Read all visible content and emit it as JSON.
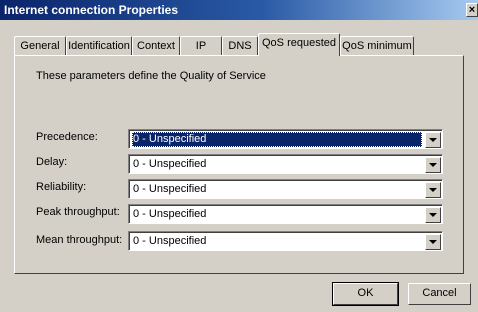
{
  "window": {
    "title": "Internet connection Properties",
    "close_glyph": "×"
  },
  "tabs": [
    {
      "label": "General"
    },
    {
      "label": "Identification"
    },
    {
      "label": "Context"
    },
    {
      "label": "IP"
    },
    {
      "label": "DNS"
    },
    {
      "label": "QoS requested",
      "active": true
    },
    {
      "label": "QoS minimum"
    }
  ],
  "panel": {
    "description": "These parameters define the Quality of Service",
    "fields": [
      {
        "label": "Precedence:",
        "value": "0 - Unspecified",
        "selected": true
      },
      {
        "label": "Delay:",
        "value": "0 - Unspecified"
      },
      {
        "label": "Reliability:",
        "value": "0 - Unspecified"
      },
      {
        "label": "Peak throughput:",
        "value": "0 - Unspecified"
      },
      {
        "label": "Mean throughput:",
        "value": "0 - Unspecified"
      }
    ]
  },
  "buttons": {
    "ok": "OK",
    "cancel": "Cancel"
  }
}
